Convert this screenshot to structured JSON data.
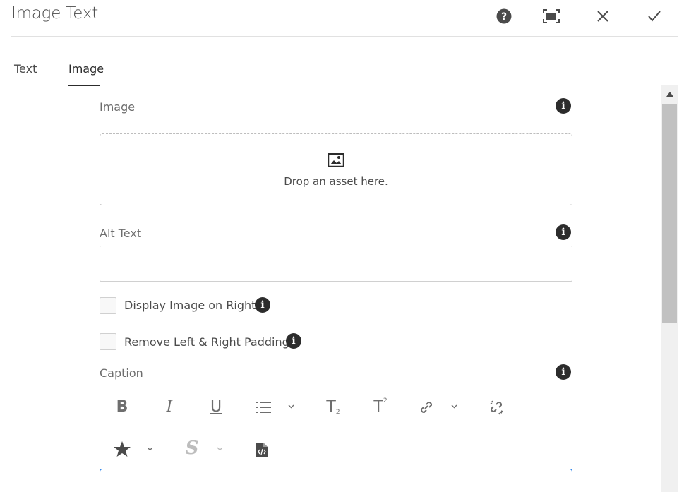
{
  "dialog": {
    "title": "Image Text",
    "actions": {
      "help": "help-icon",
      "fullscreen": "fullscreen-icon",
      "close": "close-icon",
      "done": "checkmark-icon"
    }
  },
  "tabs": [
    {
      "label": "Text",
      "selected": false
    },
    {
      "label": "Image",
      "selected": true
    }
  ],
  "form": {
    "image": {
      "label": "Image",
      "dropzone_text": "Drop an asset here."
    },
    "alt_text": {
      "label": "Alt Text",
      "value": "",
      "placeholder": ""
    },
    "display_image_right": {
      "label": "Display Image on Right",
      "checked": false
    },
    "remove_padding": {
      "label": "Remove Left & Right Padding",
      "checked": false
    },
    "caption": {
      "label": "Caption",
      "toolbar": {
        "bold": "B",
        "italic": "I",
        "underline": "U",
        "subscript": "T",
        "subscript_mark": "2",
        "superscript": "T",
        "superscript_mark": "2",
        "strikethrough": "S"
      },
      "value": ""
    }
  },
  "colors": {
    "focus_border": "#2680eb",
    "icon_dark": "#2c2c2c",
    "icon_gray": "#6e6e6e"
  }
}
